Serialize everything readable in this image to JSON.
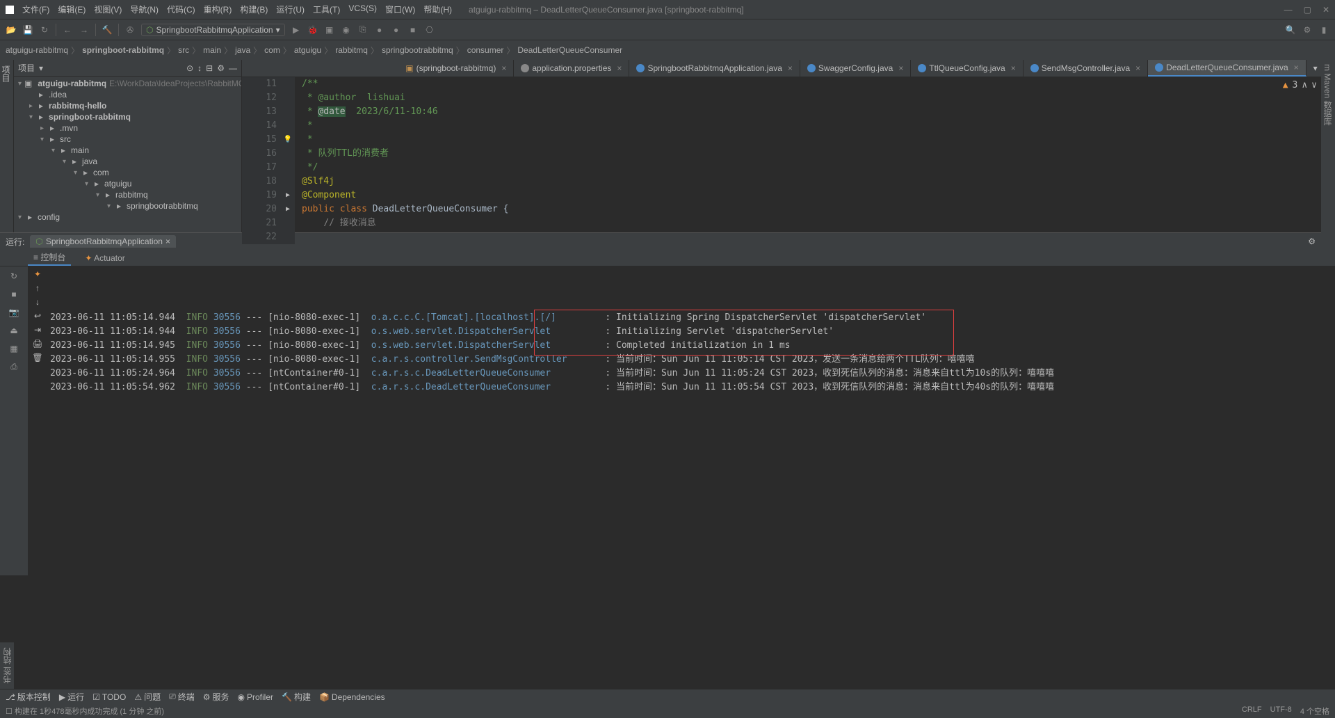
{
  "window": {
    "title": "atguigu-rabbitmq – DeadLetterQueueConsumer.java [springboot-rabbitmq]"
  },
  "menu": {
    "items": [
      "文件(F)",
      "编辑(E)",
      "视图(V)",
      "导航(N)",
      "代码(C)",
      "重构(R)",
      "构建(B)",
      "运行(U)",
      "工具(T)",
      "VCS(S)",
      "窗口(W)",
      "帮助(H)"
    ]
  },
  "toolbar": {
    "run_config": "SpringbootRabbitmqApplication"
  },
  "breadcrumb": {
    "items": [
      "atguigu-rabbitmq",
      "springboot-rabbitmq",
      "src",
      "main",
      "java",
      "com",
      "atguigu",
      "rabbitmq",
      "springbootrabbitmq",
      "consumer",
      "DeadLetterQueueConsumer"
    ]
  },
  "project_panel": {
    "title": "项目",
    "root_name": "atguigu-rabbitmq",
    "root_path": "E:\\WorkData\\IdeaProjects\\RabbitMQ\\…",
    "tree": [
      {
        "indent": 1,
        "arrow": "",
        "name": ".idea",
        "icon": "folder"
      },
      {
        "indent": 1,
        "arrow": "▸",
        "name": "rabbitmq-hello",
        "icon": "module",
        "bold": true
      },
      {
        "indent": 1,
        "arrow": "▾",
        "name": "springboot-rabbitmq",
        "icon": "module",
        "bold": true
      },
      {
        "indent": 2,
        "arrow": "▸",
        "name": ".mvn",
        "icon": "folder"
      },
      {
        "indent": 2,
        "arrow": "▾",
        "name": "src",
        "icon": "folder"
      },
      {
        "indent": 3,
        "arrow": "▾",
        "name": "main",
        "icon": "folder"
      },
      {
        "indent": 4,
        "arrow": "▾",
        "name": "java",
        "icon": "src-folder"
      },
      {
        "indent": 5,
        "arrow": "▾",
        "name": "com",
        "icon": "pkg"
      },
      {
        "indent": 6,
        "arrow": "▾",
        "name": "atguigu",
        "icon": "pkg"
      },
      {
        "indent": 7,
        "arrow": "▾",
        "name": "rabbitmq",
        "icon": "pkg"
      },
      {
        "indent": 8,
        "arrow": "▾",
        "name": "springbootrabbitmq",
        "icon": "pkg"
      },
      {
        "indent": 9,
        "arrow": "▾",
        "name": "config",
        "icon": "pkg"
      }
    ]
  },
  "editor": {
    "tabs": [
      {
        "icon": "folder",
        "label": "(springboot-rabbitmq)",
        "active": false
      },
      {
        "icon": "prop",
        "label": "application.properties",
        "active": false
      },
      {
        "icon": "java",
        "label": "SpringbootRabbitmqApplication.java",
        "active": false
      },
      {
        "icon": "java",
        "label": "SwaggerConfig.java",
        "active": false
      },
      {
        "icon": "java",
        "label": "TtlQueueConfig.java",
        "active": false
      },
      {
        "icon": "java",
        "label": "SendMsgController.java",
        "active": false
      },
      {
        "icon": "java",
        "label": "DeadLetterQueueConsumer.java",
        "active": true
      }
    ],
    "warnings": "3",
    "lines": [
      {
        "n": "11",
        "html": "<span class='doc'>/**</span>"
      },
      {
        "n": "12",
        "html": "<span class='doc'> * </span><span class='doc'>@author</span><span class='doc'>  lishuai</span>"
      },
      {
        "n": "13",
        "html": "<span class='doc'> * </span><span class='hl'>@date</span><span class='doc'>  2023/6/11-10:46</span>"
      },
      {
        "n": "14",
        "html": "<span class='doc'> *</span>"
      },
      {
        "n": "15",
        "icon": "💡",
        "html": "<span class='doc'> *</span>"
      },
      {
        "n": "16",
        "html": "<span class='doc'> * 队列TTL的消费者</span>"
      },
      {
        "n": "17",
        "html": "<span class='doc'> */</span>"
      },
      {
        "n": "18",
        "html": "<span class='ann'>@Slf4j</span>"
      },
      {
        "n": "19",
        "icon": "▶",
        "html": "<span class='ann'>@Component</span>"
      },
      {
        "n": "20",
        "icon": "▶",
        "html": "<span class='kw'>public class </span><span class='cls'>DeadLetterQueueConsumer </span>{"
      },
      {
        "n": "21",
        "html": ""
      },
      {
        "n": "22",
        "html": "    <span class='cmnt'>// 接收消息</span>"
      }
    ]
  },
  "run": {
    "label": "运行:",
    "tab": "SpringbootRabbitmqApplication",
    "sub_tabs": {
      "console": "控制台",
      "actuator": "Actuator"
    },
    "log": [
      {
        "t": "2023-06-11 11:05:14.944",
        "lvl": "INFO",
        "pid": "30556",
        "th": "[nio-8080-exec-1]",
        "cls": "o.a.c.c.C.[Tomcat].[localhost].[/]",
        "msg": ": Initializing Spring DispatcherServlet 'dispatcherServlet'"
      },
      {
        "t": "2023-06-11 11:05:14.944",
        "lvl": "INFO",
        "pid": "30556",
        "th": "[nio-8080-exec-1]",
        "cls": "o.s.web.servlet.DispatcherServlet",
        "msg": ": Initializing Servlet 'dispatcherServlet'"
      },
      {
        "t": "2023-06-11 11:05:14.945",
        "lvl": "INFO",
        "pid": "30556",
        "th": "[nio-8080-exec-1]",
        "cls": "o.s.web.servlet.DispatcherServlet",
        "msg": ": Completed initialization in 1 ms"
      },
      {
        "t": "2023-06-11 11:05:14.955",
        "lvl": "INFO",
        "pid": "30556",
        "th": "[nio-8080-exec-1]",
        "cls": "c.a.r.s.controller.SendMsgController",
        "msg": ": 当前时间：Sun Jun 11 11:05:14 CST 2023，发送一条消息给两个TTL队列：嘻嘻嘻"
      },
      {
        "t": "2023-06-11 11:05:24.964",
        "lvl": "INFO",
        "pid": "30556",
        "th": "[ntContainer#0-1]",
        "cls": "c.a.r.s.c.DeadLetterQueueConsumer",
        "msg": ": 当前时间：Sun Jun 11 11:05:24 CST 2023，收到死信队列的消息：消息来自ttl为10s的队列：嘻嘻嘻"
      },
      {
        "t": "2023-06-11 11:05:54.962",
        "lvl": "INFO",
        "pid": "30556",
        "th": "[ntContainer#0-1]",
        "cls": "c.a.r.s.c.DeadLetterQueueConsumer",
        "msg": ": 当前时间：Sun Jun 11 11:05:54 CST 2023，收到死信队列的消息：消息来自ttl为40s的队列：嘻嘻嘻"
      }
    ]
  },
  "bottom_bar": {
    "items": [
      "版本控制",
      "运行",
      "TODO",
      "问题",
      "终端",
      "服务",
      "Profiler",
      "构建",
      "Dependencies"
    ]
  },
  "status": {
    "left": "构建在 1秒478毫秒内成功完成 (1 分钟 之前)",
    "right": [
      "CRLF",
      "UTF-8",
      "4 个空格"
    ]
  },
  "side_tabs": {
    "left_top": "项目",
    "right": "m  Maven  数据库",
    "left_bottom": "书签  结构"
  }
}
